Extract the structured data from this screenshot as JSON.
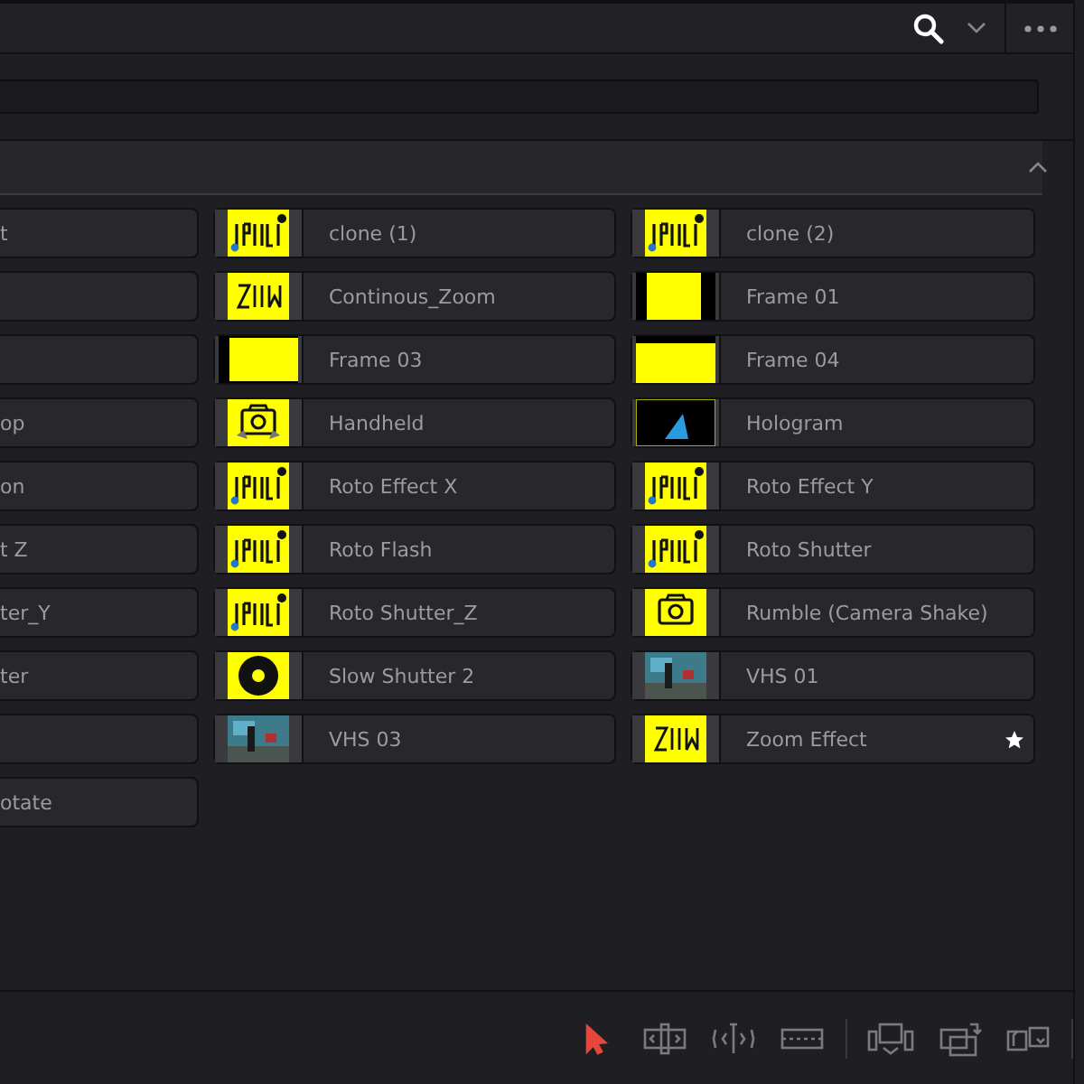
{
  "items": [
    {
      "label": "t",
      "kind": "partial",
      "favorite": false
    },
    {
      "label": "clone (1)",
      "kind": "clone",
      "favorite": false
    },
    {
      "label": "clone (2)",
      "kind": "clone",
      "favorite": false
    },
    {
      "kind": "partial",
      "favorite": false
    },
    {
      "label": "Continous_Zoom",
      "kind": "zoom",
      "favorite": false
    },
    {
      "label": "Frame 01",
      "kind": "frame-sides",
      "favorite": false
    },
    {
      "kind": "partial",
      "favorite": false
    },
    {
      "label": "Frame 03",
      "kind": "frame-left",
      "favorite": false
    },
    {
      "label": "Frame 04",
      "kind": "frame-top",
      "favorite": false
    },
    {
      "label": "op",
      "kind": "partial",
      "favorite": false
    },
    {
      "label": "Handheld",
      "kind": "handheld",
      "favorite": false
    },
    {
      "label": "Hologram",
      "kind": "hologram",
      "favorite": false
    },
    {
      "label": "on",
      "kind": "partial",
      "favorite": false
    },
    {
      "label": "Roto Effect X",
      "kind": "roto",
      "favorite": false
    },
    {
      "label": "Roto Effect Y",
      "kind": "roto",
      "favorite": false
    },
    {
      "label": "t Z",
      "kind": "partial",
      "favorite": false
    },
    {
      "label": "Roto Flash",
      "kind": "roto",
      "favorite": false
    },
    {
      "label": "Roto Shutter",
      "kind": "roto",
      "favorite": false
    },
    {
      "label": "ter_Y",
      "kind": "partial",
      "favorite": false
    },
    {
      "label": "Roto Shutter_Z",
      "kind": "roto",
      "favorite": false
    },
    {
      "label": "Rumble (Camera Shake)",
      "kind": "camera",
      "favorite": false
    },
    {
      "label": "ter",
      "kind": "partial",
      "favorite": false
    },
    {
      "label": "Slow Shutter 2",
      "kind": "shutter",
      "favorite": false
    },
    {
      "label": "VHS 01",
      "kind": "vhs",
      "favorite": false
    },
    {
      "kind": "partial",
      "favorite": false
    },
    {
      "label": "VHS 03",
      "kind": "vhs",
      "favorite": false
    },
    {
      "label": "Zoom Effect",
      "kind": "zoom",
      "favorite": true
    },
    {
      "label": "otate",
      "kind": "partial",
      "favorite": false
    }
  ],
  "tools": [
    {
      "kind": "pointer",
      "selected": true
    },
    {
      "kind": "trim",
      "selected": false
    },
    {
      "kind": "blade",
      "selected": false
    },
    {
      "kind": "film",
      "selected": false
    },
    {
      "kind": "insert",
      "selected": false
    },
    {
      "kind": "overwrite",
      "selected": false
    },
    {
      "kind": "replace",
      "selected": false
    }
  ]
}
